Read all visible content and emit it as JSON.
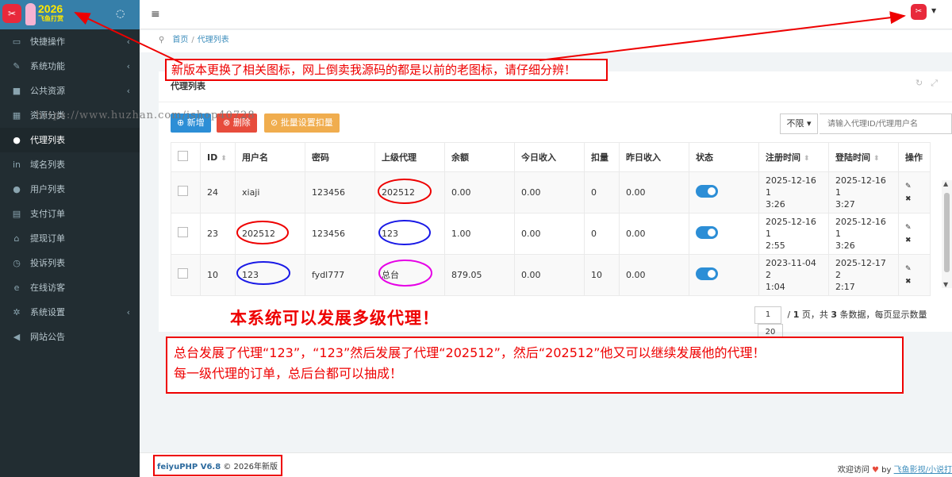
{
  "logo": {
    "year": "2026",
    "name": "飞鱼打赏",
    "icon": "fish-app-icon"
  },
  "sidebar": {
    "items": [
      {
        "label": "快捷操作",
        "icon": "dashboard-icon"
      },
      {
        "label": "系统功能",
        "icon": "wrench-icon"
      },
      {
        "label": "公共资源",
        "icon": "video-icon"
      },
      {
        "label": "资源分类",
        "icon": "grid-icon"
      },
      {
        "label": "代理列表",
        "icon": "users-icon"
      },
      {
        "label": "域名列表",
        "icon": "linkedin-icon"
      },
      {
        "label": "用户列表",
        "icon": "user-icon"
      },
      {
        "label": "支付订单",
        "icon": "file-icon"
      },
      {
        "label": "提现订单",
        "icon": "bank-icon"
      },
      {
        "label": "投诉列表",
        "icon": "clock-icon"
      },
      {
        "label": "在线访客",
        "icon": "ie-icon"
      },
      {
        "label": "系统设置",
        "icon": "gear-icon"
      },
      {
        "label": "网站公告",
        "icon": "bullhorn-icon"
      }
    ]
  },
  "breadcrumb": {
    "home": "首页",
    "current": "代理列表"
  },
  "panel": {
    "title": "代理列表"
  },
  "toolbar": {
    "add": "新增",
    "delete": "删除",
    "batch": "批量设置扣量",
    "filter": "不限",
    "search_placeholder": "请输入代理ID/代理用户名"
  },
  "table": {
    "headers": [
      "ID",
      "用户名",
      "密码",
      "上级代理",
      "余额",
      "今日收入",
      "扣量",
      "昨日收入",
      "状态",
      "注册时间",
      "登陆时间",
      "操作"
    ],
    "rows": [
      {
        "id": "24",
        "username": "xiaji",
        "password": "123456",
        "parent": "202512",
        "balance": "0.00",
        "today": "0.00",
        "deduct": "0",
        "yesterday": "0.00",
        "reg1": "2025-12-16 1",
        "reg2": "3:26",
        "login1": "2025-12-16 1",
        "login2": "3:27"
      },
      {
        "id": "23",
        "username": "202512",
        "password": "123456",
        "parent": "123",
        "balance": "1.00",
        "today": "0.00",
        "deduct": "0",
        "yesterday": "0.00",
        "reg1": "2025-12-16 1",
        "reg2": "2:55",
        "login1": "2025-12-16 1",
        "login2": "3:26"
      },
      {
        "id": "10",
        "username": "123",
        "password": "fydl777",
        "parent": "总台",
        "balance": "879.05",
        "today": "0.00",
        "deduct": "10",
        "yesterday": "0.00",
        "reg1": "2023-11-04 2",
        "reg2": "1:04",
        "login1": "2025-12-17 2",
        "login2": "2:17"
      }
    ]
  },
  "pagination": {
    "page": "1",
    "total_pages": "1",
    "total_records": "3",
    "per_page": "20",
    "text_a": "/",
    "text_b": "页，共",
    "text_c": "条数据，每页显示数量"
  },
  "annotations": {
    "top_note": "新版本更换了相关图标，网上倒卖我源码的都是以前的老图标，请仔细分辨！",
    "headline": "本系统可以发展多级代理！",
    "bottom_note_line1": "总台发展了代理“123”，“123”然后发展了代理“202512”，然后“202512”他又可以继续发展他的代理！",
    "bottom_note_line2": "每一级代理的订单，总后台都可以抽成！",
    "watermark": "https://www.huzhan.com/ishop40728"
  },
  "footer": {
    "brand": "feiyuPHP V6.8",
    "rest": "© 2026年新版",
    "welcome": "欢迎访问",
    "by": "by",
    "link": "飞鱼影视/小说打"
  },
  "colors": {
    "sidebar": "#222d32",
    "accent": "#2c8ed6",
    "annotation": "#e00000"
  }
}
